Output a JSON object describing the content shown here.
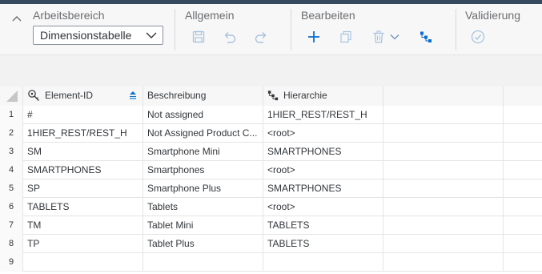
{
  "toolbar": {
    "workspace": {
      "title": "Arbeitsbereich",
      "select_value": "Dimensionstabelle"
    },
    "general": {
      "title": "Allgemein",
      "buttons": [
        "save-icon",
        "undo-icon",
        "redo-icon"
      ]
    },
    "edit": {
      "title": "Bearbeiten",
      "buttons": [
        "add-icon",
        "copy-icon",
        "delete-icon",
        "chevron-down-icon",
        "hierarchy-icon"
      ]
    },
    "validation": {
      "title": "Validierung",
      "buttons": [
        "check-circle-icon"
      ]
    }
  },
  "grid": {
    "columns": [
      {
        "label": "Element-ID",
        "icon": "key-search-icon",
        "sort": "sort-icon"
      },
      {
        "label": "Beschreibung",
        "icon": ""
      },
      {
        "label": "Hierarchie",
        "icon": "hierarchy-icon"
      },
      {
        "label": ""
      },
      {
        "label": ""
      }
    ],
    "rows": [
      {
        "num": "1",
        "id": "#",
        "desc": "Not assigned",
        "hier": "1HIER_REST/REST_H"
      },
      {
        "num": "2",
        "id": "1HIER_REST/REST_H",
        "desc": "Not Assigned Product C...",
        "hier": "<root>"
      },
      {
        "num": "3",
        "id": "SM",
        "desc": "Smartphone Mini",
        "hier": "SMARTPHONES"
      },
      {
        "num": "4",
        "id": "SMARTPHONES",
        "desc": "Smartphones",
        "hier": "<root>"
      },
      {
        "num": "5",
        "id": "SP",
        "desc": "Smartphone Plus",
        "hier": "SMARTPHONES"
      },
      {
        "num": "6",
        "id": "TABLETS",
        "desc": "Tablets",
        "hier": "<root>"
      },
      {
        "num": "7",
        "id": "TM",
        "desc": "Tablet Mini",
        "hier": "TABLETS"
      },
      {
        "num": "8",
        "id": "TP",
        "desc": "Tablet Plus",
        "hier": "TABLETS"
      },
      {
        "num": "9",
        "id": "",
        "desc": "",
        "hier": ""
      }
    ]
  },
  "colors": {
    "accent": "#0a6ed1",
    "header_strip": "#354a5f",
    "disabled_icon": "#a9c3df"
  }
}
